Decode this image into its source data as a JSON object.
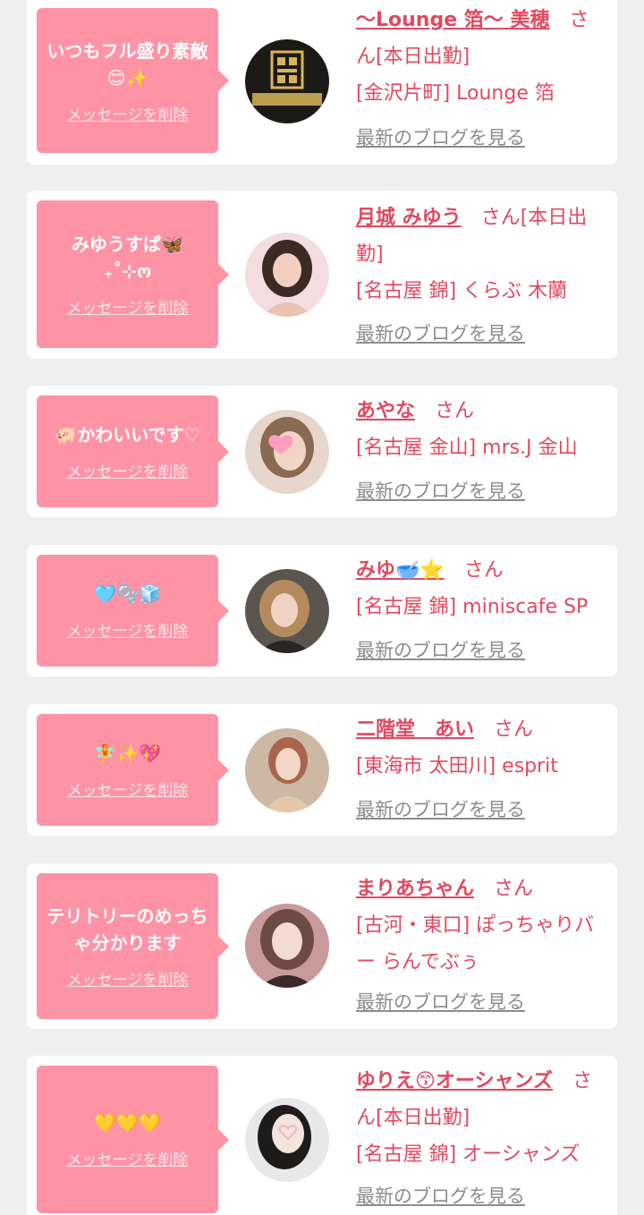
{
  "common": {
    "delete_label": "メッセージを削除",
    "blog_label": "最新のブログを見る"
  },
  "cards": [
    {
      "message": "いつもフル盛り素敵😊✨",
      "name": "〜Lounge 箔〜 美穂",
      "suffix": "さん[本日出勤]",
      "shop": "[金沢片町] Lounge 箔",
      "avatar": "lounge-logo"
    },
    {
      "message": "みゆうすぱ🦋 ₊˚⊹ო",
      "name": "月城 みゆう",
      "suffix": "さん[本日出勤]",
      "shop": "[名古屋 錦] くらぶ 木蘭",
      "avatar": "portrait"
    },
    {
      "message": "🐖かわいいです♡",
      "name": "あやな",
      "suffix": "さん",
      "shop": "[名古屋 金山] mrs.J 金山",
      "avatar": "portrait-heart"
    },
    {
      "message": "🩵🫧🧊",
      "name": "みゆ🥣⭐",
      "suffix": "さん",
      "shop": "[名古屋 錦] miniscafe SP",
      "avatar": "portrait"
    },
    {
      "message": "🧚✨💖",
      "name": "二階堂　あい",
      "suffix": "さん",
      "shop": "[東海市 太田川] esprit",
      "avatar": "portrait"
    },
    {
      "message": "テリトリーのめっちゃ分かります",
      "name": "まりあちゃん",
      "suffix": "さん",
      "shop": "[古河・東口] ぽっちゃりバー らんでぶぅ",
      "avatar": "portrait"
    },
    {
      "message": "💛💛💛",
      "name": "ゆりえ😙オーシャンズ",
      "suffix": "さん[本日出勤]",
      "shop": "[名古屋 錦] オーシャンズ",
      "avatar": "portrait-heart"
    }
  ]
}
